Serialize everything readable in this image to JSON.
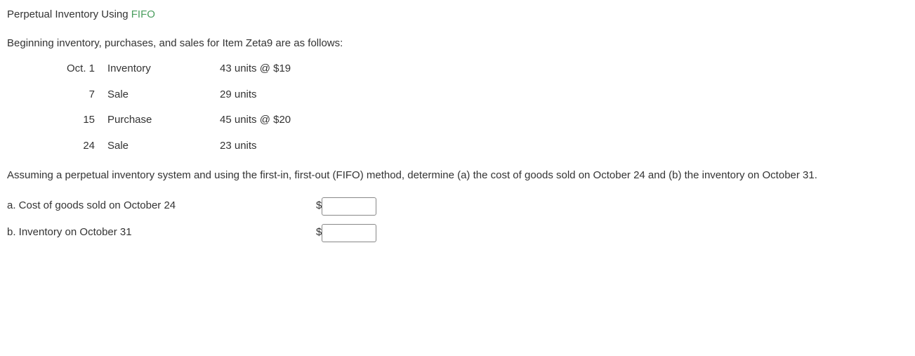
{
  "title": {
    "main": "Perpetual Inventory Using ",
    "highlight": "FIFO"
  },
  "intro": "Beginning inventory, purchases, and sales for Item Zeta9 are as follows:",
  "rows": [
    {
      "date": "Oct. 1",
      "type": "Inventory",
      "detail": "43 units @ $19"
    },
    {
      "date": "7",
      "type": "Sale",
      "detail": "29 units"
    },
    {
      "date": "15",
      "type": "Purchase",
      "detail": "45 units @ $20"
    },
    {
      "date": "24",
      "type": "Sale",
      "detail": "23 units"
    }
  ],
  "instruction": "Assuming a perpetual inventory system and using the first-in, first-out (FIFO) method, determine (a) the cost of goods sold on October 24 and (b) the inventory on October 31.",
  "answers": {
    "a": {
      "label": "a. Cost of goods sold on October 24",
      "currency": "$",
      "value": ""
    },
    "b": {
      "label": "b. Inventory on October 31",
      "currency": "$",
      "value": ""
    }
  }
}
